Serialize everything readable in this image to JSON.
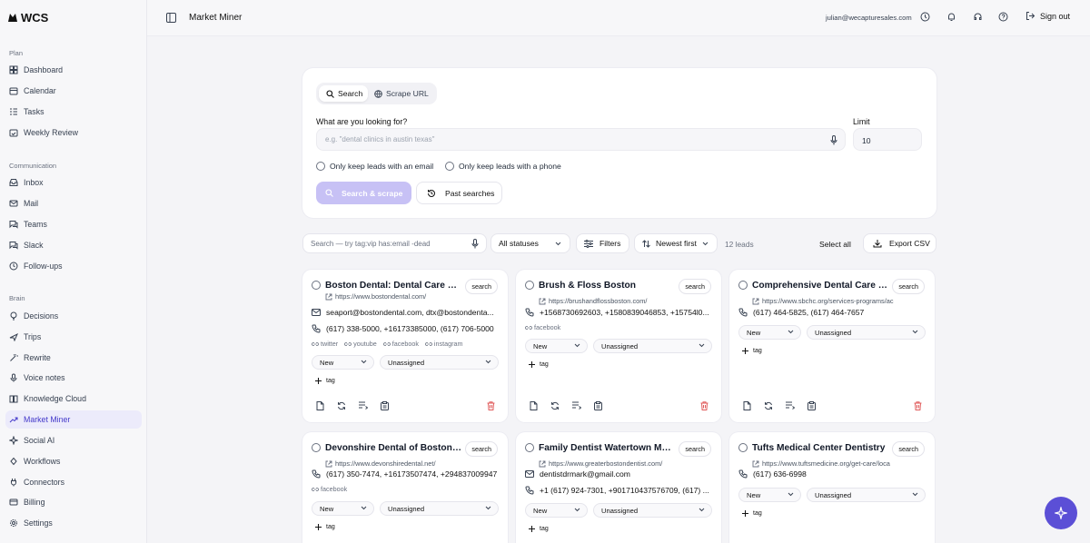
{
  "app": {
    "logo": "WCS"
  },
  "sidebar": {
    "sections": [
      "Plan",
      "Communication",
      "Brain"
    ],
    "plan": [
      "Dashboard",
      "Calendar",
      "Tasks",
      "Weekly Review"
    ],
    "communication": [
      "Inbox",
      "Mail",
      "Teams",
      "Slack",
      "Follow-ups"
    ],
    "brain": [
      "Decisions",
      "Trips",
      "Rewrite",
      "Voice notes",
      "Knowledge Cloud",
      "Market Miner",
      "Social AI",
      "Workflows",
      "Connectors",
      "Billing",
      "Settings"
    ]
  },
  "topbar": {
    "title": "Market Miner",
    "email": "julian@wecapturesales.com",
    "signout": "Sign out"
  },
  "search": {
    "tab_search": "Search",
    "tab_scrape": "Scrape URL",
    "question": "What are you looking for?",
    "placeholder": "e.g. \"dental clinics in austin texas\"",
    "limit_label": "Limit",
    "limit_value": "10",
    "opt_email": "Only keep leads with an email",
    "opt_phone": "Only keep leads with a phone",
    "scrape_button": "Search & scrape",
    "past_button": "Past searches"
  },
  "filterbar": {
    "search_placeholder": "Search — try tag:vip has:email -dead",
    "status": "All statuses",
    "filters": "Filters",
    "sort": "Newest first",
    "count": "12 leads",
    "select_all": "Select all",
    "export": "Export CSV"
  },
  "cards": [
    {
      "title": "Boston Dental: Dental Care Th...",
      "badge": "search",
      "url": "https://www.bostondental.com/",
      "email": "seaport@bostondental.com, dtx@bostondenta...",
      "phone": "(617) 338-5000, +16173385000, (617) 706-5000",
      "socials": [
        "twitter",
        "youtube",
        "facebook",
        "instagram"
      ],
      "status": "New",
      "assignee": "Unassigned",
      "tag": "tag"
    },
    {
      "title": "Brush & Floss Boston",
      "badge": "search",
      "url": "https://brushandflossboston.com/",
      "phone": "+1568730692603, +1580839046853, +15754l0...",
      "socials": [
        "facebook"
      ],
      "status": "New",
      "assignee": "Unassigned",
      "tag": "tag"
    },
    {
      "title": "Comprehensive Dental Care in ...",
      "badge": "search",
      "url": "https://www.sbchc.org/services-programs/ac",
      "phone": "(617) 464-5825, (617) 464-7657",
      "status": "New",
      "assignee": "Unassigned",
      "tag": "tag"
    },
    {
      "title": "Devonshire Dental of Boston: ...",
      "badge": "search",
      "url": "https://www.devonshiredental.net/",
      "phone": "(617) 350-7474, +16173507474, +294837009947",
      "socials": [
        "facebook"
      ],
      "status": "New",
      "assignee": "Unassigned",
      "tag": "tag"
    },
    {
      "title": "Family Dentist Watertown MA ...",
      "badge": "search",
      "url": "https://www.greaterbostondentist.com/",
      "email": "dentistdrmark@gmail.com",
      "phone": "+1 (617) 924-7301, +901710437576709, (617) ...",
      "status": "New",
      "assignee": "Unassigned",
      "tag": "tag"
    },
    {
      "title": "Tufts Medical Center Dentistry",
      "badge": "search",
      "url": "https://www.tuftsmedicine.org/get-care/loca",
      "phone": "(617) 636-6998",
      "status": "New",
      "assignee": "Unassigned",
      "tag": "tag"
    }
  ],
  "colors": {
    "accent": "#5b4fd6",
    "accent_light": "#c7c1f5",
    "active_bg": "#ecebfb",
    "danger": "#e05a5a"
  }
}
